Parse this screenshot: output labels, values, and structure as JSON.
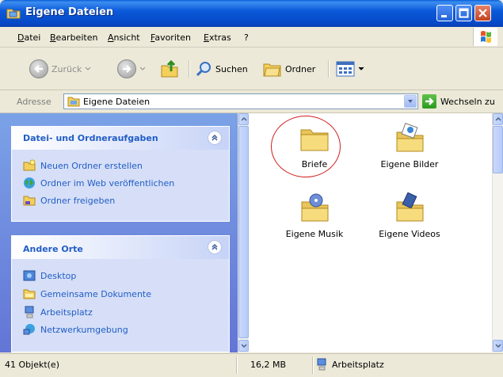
{
  "window": {
    "title": "Eigene Dateien"
  },
  "menu": [
    "Datei",
    "Bearbeiten",
    "Ansicht",
    "Favoriten",
    "Extras",
    "?"
  ],
  "toolbar": {
    "back": "Zurück",
    "search": "Suchen",
    "folders": "Ordner"
  },
  "address": {
    "label": "Adresse",
    "value": "Eigene Dateien",
    "go": "Wechseln zu"
  },
  "tasks": {
    "title": "Datei- und Ordneraufgaben",
    "items": [
      "Neuen Ordner erstellen",
      "Ordner im Web veröffentlichen",
      "Ordner freigeben"
    ]
  },
  "places": {
    "title": "Andere Orte",
    "items": [
      "Desktop",
      "Gemeinsame Dokumente",
      "Arbeitsplatz",
      "Netzwerkumgebung"
    ]
  },
  "files": [
    {
      "name": "Briefe",
      "icon": "folder-icon"
    },
    {
      "name": "Eigene Bilder",
      "icon": "pictures-folder-icon"
    },
    {
      "name": "Eigene Musik",
      "icon": "music-folder-icon"
    },
    {
      "name": "Eigene Videos",
      "icon": "videos-folder-icon"
    }
  ],
  "status": {
    "objects": "41 Objekt(e)",
    "size": "16,2 MB",
    "location": "Arbeitsplatz"
  },
  "colors": {
    "titlebar": "#0b59d9",
    "task_link": "#215dc6",
    "highlight_ring": "#d21e1e"
  }
}
